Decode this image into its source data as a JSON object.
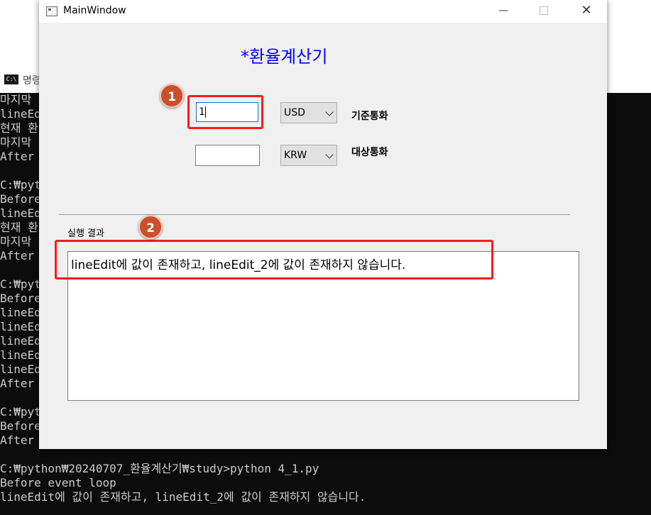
{
  "console": {
    "title": "명령",
    "side_lines": [
      "마지막",
      "lineEd",
      "현재 환",
      "마지막",
      "After",
      "",
      "C:₩pyt",
      "Before",
      "lineEd",
      "현재 환",
      "마지막",
      "After",
      "",
      "C:₩pyt",
      "Before",
      "lineEd",
      "lineEd",
      "lineEd",
      "lineEd",
      "lineEd",
      "After",
      "",
      "C:₩pyt",
      "Before",
      "After"
    ],
    "bottom_lines": [
      "C:₩python₩20240707_환율계산기₩study>python 4_1.py",
      "Before event loop",
      "lineEdit에 값이 존재하고, lineEdit_2에 값이 존재하지 않습니다."
    ]
  },
  "window": {
    "title": "MainWindow",
    "controls": {
      "minimize": "—",
      "close": "✕"
    }
  },
  "app": {
    "title": "*환율계산기",
    "line_edit_1_value": "1",
    "line_edit_2_value": "",
    "combo_1_value": "USD",
    "combo_2_value": "KRW",
    "label_base": "기준통화",
    "label_target": "대상통화",
    "result_label": "실행 결과",
    "result_text": "lineEdit에 값이 존재하고, lineEdit_2에 값이 존재하지 않습니다."
  },
  "annotations": {
    "badge_1": "1",
    "badge_2": "2",
    "highlight_color": "#ff1a1a",
    "badge_color": "#c9502a"
  }
}
